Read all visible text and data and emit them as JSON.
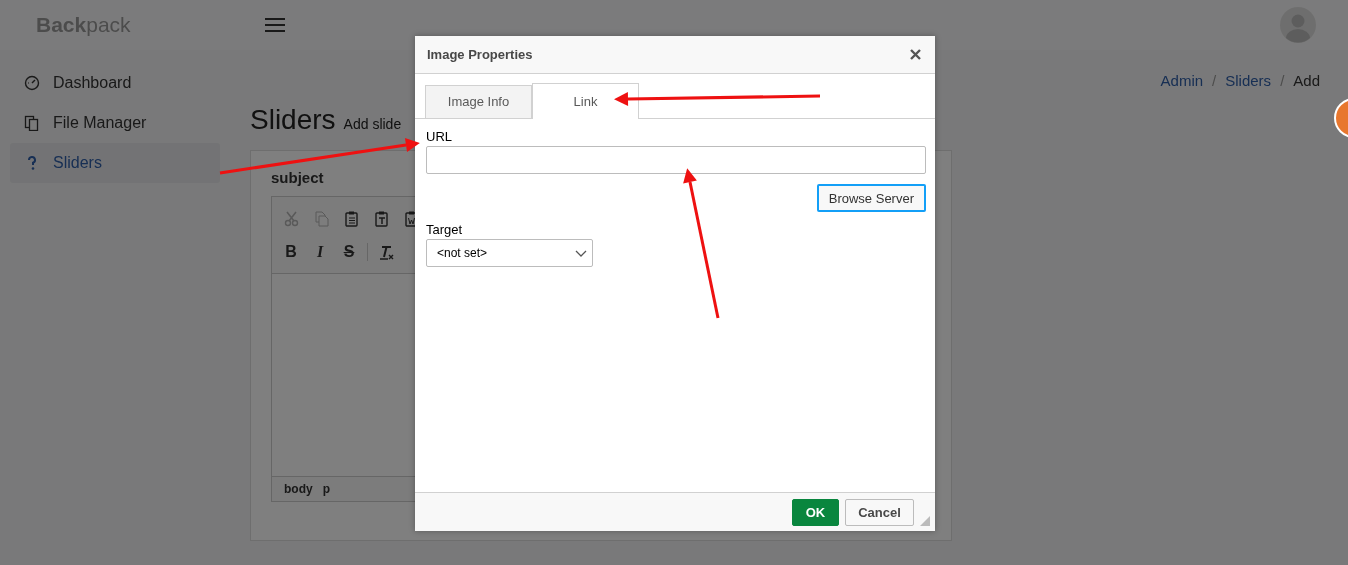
{
  "app": {
    "brand": "**Back**pack"
  },
  "sidebar": {
    "items": [
      {
        "label": "Dashboard",
        "selected": false
      },
      {
        "label": "File Manager",
        "selected": false
      },
      {
        "label": "Sliders",
        "selected": true
      }
    ]
  },
  "breadcrumb": {
    "separator": "/",
    "items": [
      {
        "label": "Admin",
        "link": true
      },
      {
        "label": "Sliders",
        "link": true
      },
      {
        "label": "Add",
        "link": false
      }
    ]
  },
  "page": {
    "title": "Sliders",
    "subtitle": "Add slide"
  },
  "field": {
    "label": "subject",
    "editor": {
      "toolbar_rows": [
        [
          {
            "kind": "cut",
            "disabled": true
          },
          {
            "kind": "copy",
            "disabled": true
          },
          {
            "kind": "paste",
            "disabled": false
          },
          {
            "kind": "pastetext",
            "disabled": false
          },
          {
            "kind": "pasteword",
            "disabled": false
          }
        ],
        [
          {
            "kind": "bold",
            "label": "B",
            "disabled": false
          },
          {
            "kind": "italic",
            "label": "I",
            "disabled": false
          },
          {
            "kind": "strike",
            "label": "S",
            "disabled": false
          },
          {
            "kind": "separator"
          },
          {
            "kind": "clearformat",
            "disabled": false
          }
        ]
      ],
      "path": [
        "body",
        "p"
      ]
    }
  },
  "dialog": {
    "title": "Image Properties",
    "tabs": [
      {
        "label": "Image Info",
        "selected": false
      },
      {
        "label": "Link",
        "selected": true
      }
    ],
    "url_label": "URL",
    "browse_button": {
      "label": "Browse Server",
      "focused": true
    },
    "target": {
      "label": "Target",
      "value": "<not set>"
    },
    "buttons": [
      {
        "label": "OK",
        "kind": "primary"
      },
      {
        "label": "Cancel",
        "kind": "secondary"
      }
    ]
  }
}
